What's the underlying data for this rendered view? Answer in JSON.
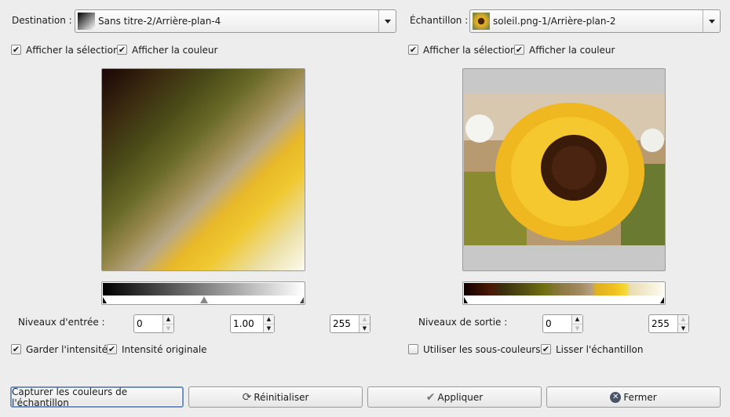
{
  "destination": {
    "label": "Destination :",
    "value": "Sans titre-2/Arrière-plan-4",
    "show_selection": {
      "label": "Afficher la sélection",
      "checked": true
    },
    "show_color": {
      "label": "Afficher la couleur",
      "checked": true
    }
  },
  "sample": {
    "label": "Échantillon :",
    "value": "soleil.png-1/Arrière-plan-2",
    "show_selection": {
      "label": "Afficher la sélection",
      "checked": true
    },
    "show_color": {
      "label": "Afficher la couleur",
      "checked": true
    }
  },
  "input_levels": {
    "label": "Niveaux d'entrée :",
    "low": "0",
    "gamma": "1.00",
    "high": "255"
  },
  "output_levels": {
    "label": "Niveaux de sortie :",
    "low": "0",
    "high": "255"
  },
  "options": {
    "keep_intensity": {
      "label": "Garder l'intensité",
      "checked": true
    },
    "original_intensity": {
      "label": "Intensité originale",
      "checked": true
    },
    "use_subcolors": {
      "label": "Utiliser les sous-couleurs",
      "checked": false
    },
    "smooth_sample": {
      "label": "Lisser l'échantillon",
      "checked": true
    }
  },
  "buttons": {
    "capture": "Capturer les couleurs de l'échantillon",
    "reset": "Réinitialiser",
    "apply": "Appliquer",
    "close": "Fermer"
  },
  "check_mark": "✔"
}
